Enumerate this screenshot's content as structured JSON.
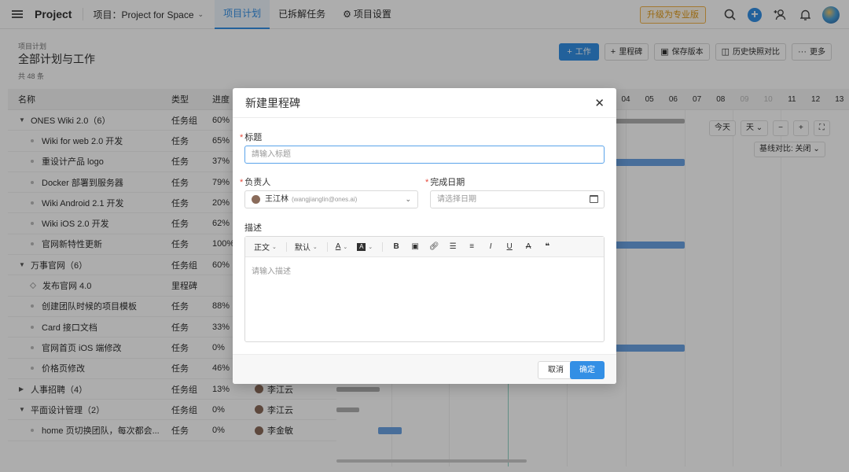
{
  "topbar": {
    "app_name": "Project",
    "project_label": "项目：Project for Space",
    "tabs": [
      {
        "label": "项目计划",
        "active": true
      },
      {
        "label": "已拆解任务",
        "active": false
      },
      {
        "label": "项目设置",
        "active": false
      }
    ],
    "upgrade_label": "升级为专业版"
  },
  "header": {
    "breadcrumb": "项目计划",
    "title": "全部计划与工作",
    "count": "共 48 条",
    "actions": {
      "work": "工作",
      "milestone": "里程碑",
      "save_version": "保存版本",
      "snapshot": "历史快照对比",
      "more": "更多"
    }
  },
  "table": {
    "headers": {
      "name": "名称",
      "type": "类型",
      "progress": "进度"
    },
    "rows": [
      {
        "name": "ONES Wiki 2.0（6）",
        "type": "任务组",
        "progress": "60%",
        "owner": "",
        "kind": "group-open"
      },
      {
        "name": "Wiki for web 2.0 开发",
        "type": "任务",
        "progress": "65%",
        "owner": "",
        "kind": "task"
      },
      {
        "name": "重设计产品 logo",
        "type": "任务",
        "progress": "37%",
        "owner": "",
        "kind": "task"
      },
      {
        "name": "Docker 部署到服务器",
        "type": "任务",
        "progress": "79%",
        "owner": "",
        "kind": "task"
      },
      {
        "name": "Wiki Android 2.1 开发",
        "type": "任务",
        "progress": "20%",
        "owner": "",
        "kind": "task"
      },
      {
        "name": "Wiki iOS 2.0 开发",
        "type": "任务",
        "progress": "62%",
        "owner": "",
        "kind": "task"
      },
      {
        "name": "官网新特性更新",
        "type": "任务",
        "progress": "100%",
        "owner": "",
        "kind": "task"
      },
      {
        "name": "万事官网（6）",
        "type": "任务组",
        "progress": "60%",
        "owner": "",
        "kind": "group-open"
      },
      {
        "name": "发布官网 4.0",
        "type": "里程碑",
        "progress": "",
        "owner": "",
        "kind": "milestone"
      },
      {
        "name": "创建团队时候的项目模板",
        "type": "任务",
        "progress": "88%",
        "owner": "",
        "kind": "task"
      },
      {
        "name": "Card 接口文档",
        "type": "任务",
        "progress": "33%",
        "owner": "",
        "kind": "task"
      },
      {
        "name": "官网首页 iOS 端修改",
        "type": "任务",
        "progress": "0%",
        "owner": "",
        "kind": "task"
      },
      {
        "name": "价格页修改",
        "type": "任务",
        "progress": "46%",
        "owner": "",
        "kind": "task"
      },
      {
        "name": "人事招聘（4）",
        "type": "任务组",
        "progress": "13%",
        "owner": "李江云",
        "kind": "group-closed"
      },
      {
        "name": "平面设计管理（2）",
        "type": "任务组",
        "progress": "0%",
        "owner": "李江云",
        "kind": "group-open"
      },
      {
        "name": "home 页切换团队，每次都会...",
        "type": "任务",
        "progress": "0%",
        "owner": "李金敏",
        "kind": "task"
      }
    ]
  },
  "gantt": {
    "days": [
      "04",
      "05",
      "06",
      "07",
      "08",
      "09",
      "10",
      "11",
      "12",
      "13"
    ],
    "muted_days": [
      "09",
      "10"
    ],
    "today_label": "今天",
    "unit_label": "天",
    "baseline_label": "基线对比: 关闭"
  },
  "modal": {
    "title": "新建里程碑",
    "title_label": "标题",
    "title_placeholder": "請输入标题",
    "assignee_label": "负责人",
    "assignee_name": "王江林",
    "assignee_email": "(wangjianglin@ones.ai)",
    "due_label": "完成日期",
    "due_placeholder": "请选择日期",
    "desc_label": "描述",
    "toolbar": {
      "paragraph": "正文",
      "font": "默认"
    },
    "desc_placeholder": "请输入描述",
    "cancel_label": "取消",
    "ok_label": "确定"
  },
  "colors": {
    "accent": "#338fe5",
    "upgrade": "#e09a1a",
    "required": "#e5493a"
  }
}
